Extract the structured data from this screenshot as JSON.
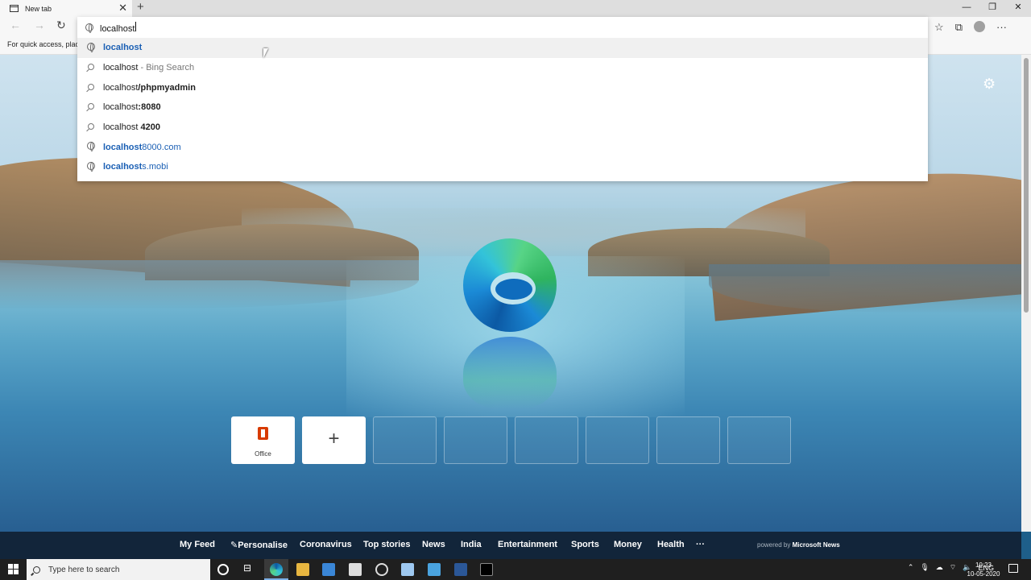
{
  "browser": {
    "tab_title": "New tab",
    "tab_close_glyph": "✕",
    "new_tab_glyph": "+",
    "window_buttons": [
      "—",
      "❐",
      "✕"
    ],
    "favorites_hint": "For quick access, place y"
  },
  "omnibox": {
    "value": "localhost",
    "suggestions": [
      {
        "type": "url",
        "icon": "globe-icon",
        "text_bold": "localhost",
        "text_rest": "",
        "style": "blue"
      },
      {
        "type": "search",
        "icon": "search-icon",
        "text_plain": "localhost",
        "text_suffix": " - Bing Search"
      },
      {
        "type": "search",
        "icon": "search-icon",
        "text_plain": "localhost",
        "text_bold": "/phpmyadmin"
      },
      {
        "type": "search",
        "icon": "search-icon",
        "text_plain": "localhost",
        "text_bold": ":8080"
      },
      {
        "type": "search",
        "icon": "search-icon",
        "text_plain": "localhost ",
        "text_bold": "4200"
      },
      {
        "type": "url",
        "icon": "globe-icon",
        "text_bold": "localhost",
        "text_rest": "8000.com",
        "style": "blue"
      },
      {
        "type": "url",
        "icon": "globe-icon",
        "text_bold": "localhost",
        "text_rest": "s.mobi",
        "style": "blue"
      }
    ]
  },
  "quick_links": [
    {
      "label": "Office",
      "icon": "office-icon"
    },
    {
      "label": "",
      "icon": "plus-icon"
    }
  ],
  "news_nav": [
    "My Feed",
    "Personalise",
    "Coronavirus",
    "Top stories",
    "News",
    "India",
    "Entertainment",
    "Sports",
    "Money",
    "Health",
    "···"
  ],
  "powered_by": {
    "prefix": "powered by ",
    "brand": "Microsoft News"
  },
  "taskbar": {
    "search_placeholder": "Type here to search",
    "language": "ENG",
    "time": "10:23",
    "date": "10-05-2020"
  }
}
